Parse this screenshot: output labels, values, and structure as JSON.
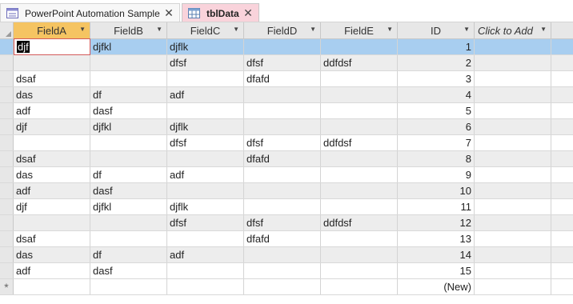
{
  "tabs": [
    {
      "label": "PowerPoint Automation Sample",
      "icon": "form-icon",
      "active": false
    },
    {
      "label": "tblData",
      "icon": "table-icon",
      "active": true
    }
  ],
  "columns": [
    "FieldA",
    "FieldB",
    "FieldC",
    "FieldD",
    "FieldE",
    "ID",
    "Click to Add"
  ],
  "rows": [
    [
      "djf",
      "djfkl",
      "djflk",
      "",
      "",
      "1"
    ],
    [
      "",
      "",
      "dfsf",
      "dfsf",
      "ddfdsf",
      "2"
    ],
    [
      "dsaf",
      "",
      "",
      "dfafd",
      "",
      "3"
    ],
    [
      "das",
      "df",
      "adf",
      "",
      "",
      "4"
    ],
    [
      "adf",
      "dasf",
      "",
      "",
      "",
      "5"
    ],
    [
      "djf",
      "djfkl",
      "djflk",
      "",
      "",
      "6"
    ],
    [
      "",
      "",
      "dfsf",
      "dfsf",
      "ddfdsf",
      "7"
    ],
    [
      "dsaf",
      "",
      "",
      "dfafd",
      "",
      "8"
    ],
    [
      "das",
      "df",
      "adf",
      "",
      "",
      "9"
    ],
    [
      "adf",
      "dasf",
      "",
      "",
      "",
      "10"
    ],
    [
      "djf",
      "djfkl",
      "djflk",
      "",
      "",
      "11"
    ],
    [
      "",
      "",
      "dfsf",
      "dfsf",
      "ddfdsf",
      "12"
    ],
    [
      "dsaf",
      "",
      "",
      "dfafd",
      "",
      "13"
    ],
    [
      "das",
      "df",
      "adf",
      "",
      "",
      "14"
    ],
    [
      "adf",
      "dasf",
      "",
      "",
      "",
      "15"
    ]
  ],
  "new_row": {
    "marker": "*",
    "id_label": "(New)"
  },
  "colors": {
    "accent_tab": "#f9d3db",
    "selected_header": "#f5c462",
    "current_row": "#a8cef0"
  }
}
